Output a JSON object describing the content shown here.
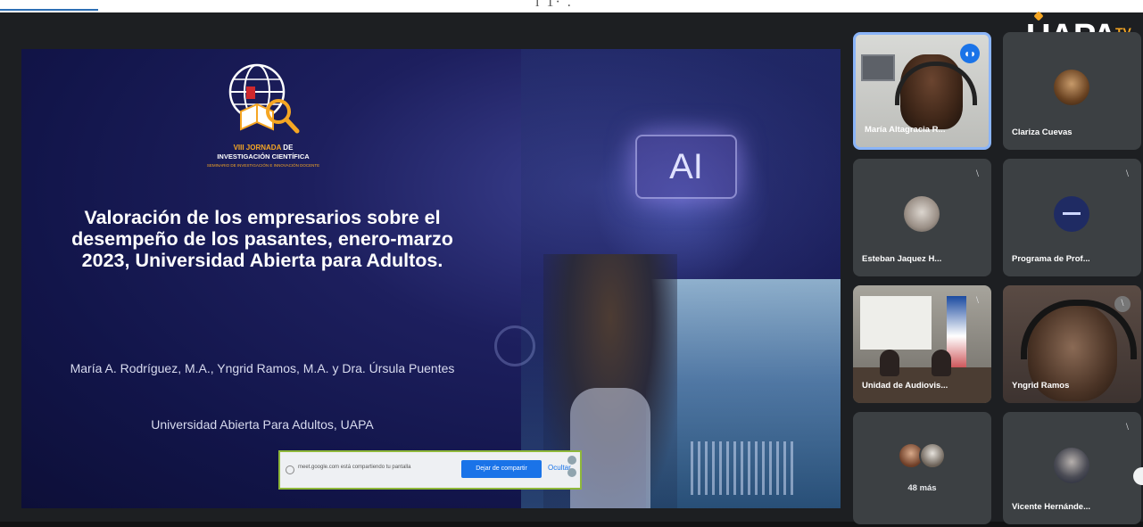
{
  "page": {
    "partial_heading": "i 1· ."
  },
  "slide": {
    "logo": {
      "line1_prefix": "VIII JORNADA",
      "line1_suffix": "DE",
      "line2": "INVESTIGACIÓN CIENTÍFICA",
      "line3": "SEMINARIO DE INVESTIGACIÓN E INNOVACIÓN DOCENTE"
    },
    "ai_label": "AI",
    "title": "Valoración de los empresarios sobre el desempeño de los pasantes, enero-marzo 2023, Universidad Abierta para Adultos.",
    "authors": "María A.  Rodríguez, M.A.,  Yngrid Ramos, M.A. y Dra. Úrsula Puentes",
    "institution": "Universidad Abierta Para Adultos, UAPA"
  },
  "share_bar": {
    "message": "meet.google.com está compartiendo tu pantalla",
    "stop_label": "Dejar de compartir",
    "hide_label": "Ocultar"
  },
  "branding": {
    "logo_text": "UAPA",
    "tv_text": "TV"
  },
  "participants": [
    {
      "name": "María Altagracia R...",
      "speaking": true
    },
    {
      "name": "Clariza Cuevas"
    },
    {
      "name": "Esteban Jaquez H..."
    },
    {
      "name": "Programa de Prof..."
    },
    {
      "name": "Unidad de Audiovis..."
    },
    {
      "name": "Yngrid Ramos"
    },
    {
      "name": "48 más"
    },
    {
      "name": "Vicente Hernánde..."
    }
  ],
  "icons": {
    "mic_off": "⧵",
    "speaking": "◖◗"
  },
  "colors": {
    "accent": "#1a73e8",
    "brand_orange": "#f5a623",
    "tile_bg": "#3c4043"
  }
}
